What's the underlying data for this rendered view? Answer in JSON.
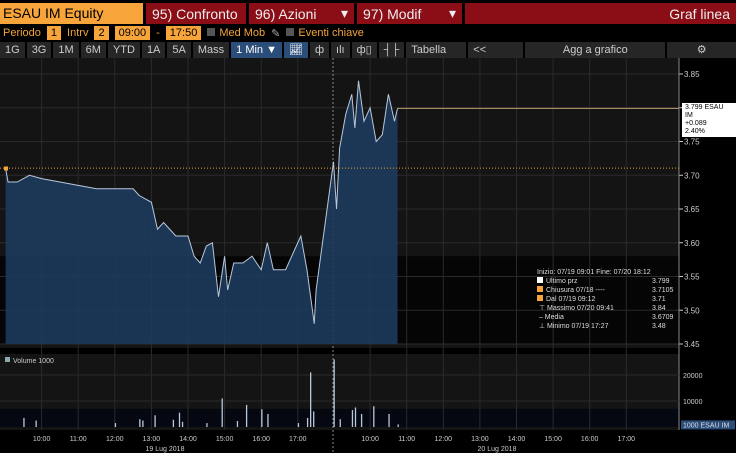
{
  "header": {
    "ticker": "ESAU IM Equity",
    "compare": "95) Confronto",
    "actions": "96) Azioni",
    "modify": "97) Modif",
    "chart_type": "Graf linea"
  },
  "controls": {
    "period_label": "Periodo",
    "period_value": "1",
    "interval_label": "Intrv",
    "interval_value": "2",
    "start_time": "09:00",
    "dash": "-",
    "end_time": "17:50",
    "moving_avg": "Med Mob",
    "key_events": "Eventi chiave"
  },
  "toolbar": {
    "ranges": [
      "1G",
      "3G",
      "1M",
      "6M",
      "YTD",
      "1A",
      "5A",
      "Mass"
    ],
    "interval": "1 Min ▼",
    "table": "Tabella",
    "collapse": "<<",
    "add_to_chart": "Agg a grafico"
  },
  "colors": {
    "accent": "#f7a43a",
    "header_red": "#8b0d16",
    "area": "#1d3a5c",
    "line": "#b8c8dc"
  },
  "chart_data": {
    "type": "line",
    "price_axis": {
      "ticks": [
        "3.85",
        "3.80",
        "3.75",
        "3.70",
        "3.65",
        "3.60",
        "3.55",
        "3.50",
        "3.45"
      ],
      "range": [
        3.45,
        3.85
      ]
    },
    "time_ticks_day1": [
      "10:00",
      "11:00",
      "12:00",
      "13:00",
      "14:00",
      "15:00",
      "16:00",
      "17:00"
    ],
    "time_ticks_day2": [
      "10:00",
      "11:00",
      "12:00",
      "13:00",
      "14:00",
      "15:00",
      "16:00",
      "17:00"
    ],
    "date_labels": [
      "19 Lug 2018",
      "20 Lug 2018"
    ],
    "price_series": [
      [
        0,
        "09:01",
        3.71
      ],
      [
        0,
        "09:05",
        3.69
      ],
      [
        0,
        "09:20",
        3.69
      ],
      [
        0,
        "09:40",
        3.7
      ],
      [
        0,
        "10:00",
        3.695
      ],
      [
        0,
        "11:30",
        3.68
      ],
      [
        0,
        "12:30",
        3.68
      ],
      [
        0,
        "12:40",
        3.67
      ],
      [
        0,
        "13:00",
        3.66
      ],
      [
        0,
        "13:10",
        3.62
      ],
      [
        0,
        "13:20",
        3.63
      ],
      [
        0,
        "13:30",
        3.62
      ],
      [
        0,
        "13:40",
        3.61
      ],
      [
        0,
        "14:00",
        3.61
      ],
      [
        0,
        "14:10",
        3.58
      ],
      [
        0,
        "14:20",
        3.57
      ],
      [
        0,
        "14:30",
        3.595
      ],
      [
        0,
        "14:40",
        3.6
      ],
      [
        0,
        "14:50",
        3.52
      ],
      [
        0,
        "15:00",
        3.58
      ],
      [
        0,
        "15:05",
        3.53
      ],
      [
        0,
        "15:15",
        3.57
      ],
      [
        0,
        "15:30",
        3.57
      ],
      [
        0,
        "15:45",
        3.58
      ],
      [
        0,
        "16:00",
        3.56
      ],
      [
        0,
        "16:10",
        3.6
      ],
      [
        0,
        "16:20",
        3.56
      ],
      [
        0,
        "16:40",
        3.56
      ],
      [
        0,
        "17:00",
        3.6
      ],
      [
        0,
        "17:05",
        3.61
      ],
      [
        0,
        "17:15",
        3.56
      ],
      [
        0,
        "17:27",
        3.48
      ],
      [
        0,
        "17:30",
        3.53
      ],
      [
        1,
        "09:00",
        3.72
      ],
      [
        1,
        "09:05",
        3.65
      ],
      [
        1,
        "09:10",
        3.74
      ],
      [
        1,
        "09:20",
        3.79
      ],
      [
        1,
        "09:30",
        3.82
      ],
      [
        1,
        "09:35",
        3.77
      ],
      [
        1,
        "09:41",
        3.84
      ],
      [
        1,
        "09:50",
        3.78
      ],
      [
        1,
        "10:00",
        3.8
      ],
      [
        1,
        "10:10",
        3.75
      ],
      [
        1,
        "10:20",
        3.76
      ],
      [
        1,
        "10:30",
        3.82
      ],
      [
        1,
        "10:40",
        3.78
      ],
      [
        1,
        "10:45",
        3.799
      ]
    ],
    "last_price": 3.799,
    "prev_close": 3.7105,
    "last_tag": {
      "price": "3.799 ESAU IM",
      "change": "+0.089",
      "pct": "2.40%"
    },
    "volume_axis": {
      "ticks": [
        "20000",
        "10000"
      ],
      "range": [
        0,
        30000
      ]
    },
    "volume_label": "Volume 1000",
    "volume_tag": "1000 ESAU IM",
    "volume_series": [
      [
        0,
        "09:30",
        3500
      ],
      [
        0,
        "09:50",
        2500
      ],
      [
        0,
        "12:00",
        1500
      ],
      [
        0,
        "12:40",
        3000
      ],
      [
        0,
        "12:45",
        2500
      ],
      [
        0,
        "13:05",
        4500
      ],
      [
        0,
        "13:35",
        2800
      ],
      [
        0,
        "13:45",
        5500
      ],
      [
        0,
        "13:50",
        2000
      ],
      [
        0,
        "14:30",
        1500
      ],
      [
        0,
        "14:55",
        11000
      ],
      [
        0,
        "15:20",
        2300
      ],
      [
        0,
        "15:35",
        8500
      ],
      [
        0,
        "16:00",
        6800
      ],
      [
        0,
        "16:10",
        5000
      ],
      [
        0,
        "17:00",
        1500
      ],
      [
        0,
        "17:15",
        3500
      ],
      [
        0,
        "17:20",
        21000
      ],
      [
        0,
        "17:25",
        6000
      ],
      [
        1,
        "09:00",
        26000
      ],
      [
        1,
        "09:10",
        3000
      ],
      [
        1,
        "09:30",
        6500
      ],
      [
        1,
        "09:35",
        7500
      ],
      [
        1,
        "09:45",
        5000
      ],
      [
        1,
        "10:05",
        8000
      ],
      [
        1,
        "10:30",
        5000
      ],
      [
        1,
        "10:45",
        1000
      ]
    ],
    "legend": {
      "range": "Inizio: 07/19 09:01 Fine: 07/20 18:12",
      "items": [
        {
          "label": "Ultimo prz",
          "value": "3.799"
        },
        {
          "label": "Chiusura 07/18 ----",
          "value": "3.7105"
        },
        {
          "label": "Dal 07/19 09:12",
          "value": "3.71"
        },
        {
          "label": "Massimo 07/20 09:41",
          "value": "3.84"
        },
        {
          "label": "Media",
          "value": "3.6709"
        },
        {
          "label": "Minimo 07/19 17:27",
          "value": "3.48"
        }
      ]
    }
  }
}
